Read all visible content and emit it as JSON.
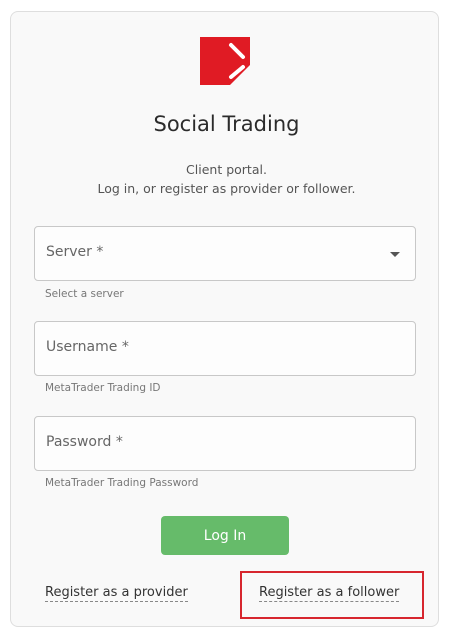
{
  "brand": {
    "logo_icon": "social-trading-logo-icon",
    "colors": {
      "logo_red": "#e01b24",
      "login_green": "#66bb6a",
      "highlight_red": "#d7262e"
    }
  },
  "header": {
    "title": "Social Trading",
    "subtitle_line1": "Client portal.",
    "subtitle_line2": "Log in, or register as provider or follower."
  },
  "form": {
    "server": {
      "label": "Server *",
      "helper": "Select a server",
      "icon": "chevron-down-icon"
    },
    "username": {
      "label": "Username *",
      "helper": "MetaTrader Trading ID"
    },
    "password": {
      "label": "Password *",
      "helper": "MetaTrader Trading Password"
    },
    "login_label": "Log In"
  },
  "links": {
    "register_provider": "Register as a provider",
    "register_follower": "Register as a follower"
  }
}
